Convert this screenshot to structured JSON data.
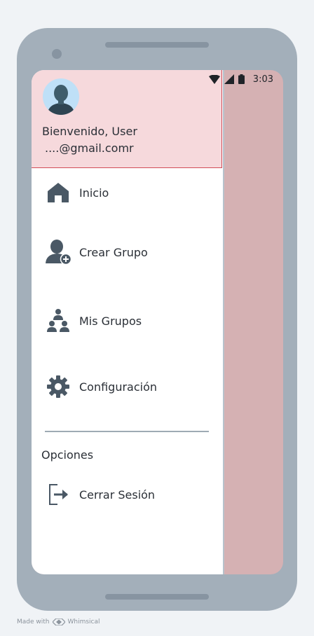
{
  "status_bar": {
    "time": "3:03"
  },
  "header": {
    "greeting": "Bienvenido, User",
    "email": "....@gmail.comr"
  },
  "menu": {
    "items": [
      {
        "label": "Inicio",
        "icon": "home-icon"
      },
      {
        "label": "Crear Grupo",
        "icon": "add-user-icon"
      },
      {
        "label": "Mis Grupos",
        "icon": "groups-icon"
      },
      {
        "label": "Configuración",
        "icon": "gear-icon"
      }
    ],
    "section_label": "Opciones",
    "logout_label": "Cerrar Sesión"
  },
  "footer": {
    "made_with": "Made with",
    "brand": "Whimsical"
  },
  "colors": {
    "header_bg": "#f6d9dc",
    "header_border": "#d24b57",
    "scrim": "#d5b1b3",
    "icon": "#4a5865"
  }
}
